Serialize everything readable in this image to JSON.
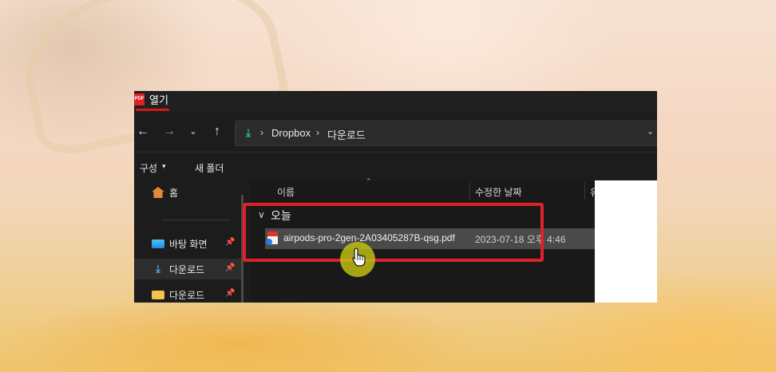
{
  "dialog": {
    "title": "열기",
    "app_icon_text": "PDF"
  },
  "nav": {
    "back": "←",
    "forward": "→",
    "recent": "⌄",
    "up": "↑"
  },
  "address": {
    "icon": "download-icon",
    "separator": "›",
    "crumbs": [
      "Dropbox",
      "다운로드"
    ],
    "dropdown": "⌄"
  },
  "toolbar": {
    "organize": "구성",
    "organize_caret": "▾",
    "new_folder": "새 폴더"
  },
  "sidebar": {
    "items": [
      {
        "label": "홈",
        "icon": "home-icon",
        "pinned": false
      },
      {
        "label": "바탕 화면",
        "icon": "desktop-icon",
        "pinned": true
      },
      {
        "label": "다운로드",
        "icon": "download-icon",
        "pinned": true,
        "selected": true
      },
      {
        "label": "다운로드",
        "icon": "folder-icon",
        "pinned": true
      }
    ],
    "pin_glyph": "📌"
  },
  "columns": {
    "name": "이름",
    "date": "수정한 날짜",
    "third": "유"
  },
  "group": {
    "label": "오늘",
    "chevron": "∨"
  },
  "file": {
    "name": "airpods-pro-2gen-2A03405287B-qsg.pdf",
    "modified": "2023-07-18 오후 4:46"
  },
  "colors": {
    "highlight": "#e0202a",
    "cursor_ring": "#bebe14",
    "dialog_bg": "#1c1c1c"
  }
}
